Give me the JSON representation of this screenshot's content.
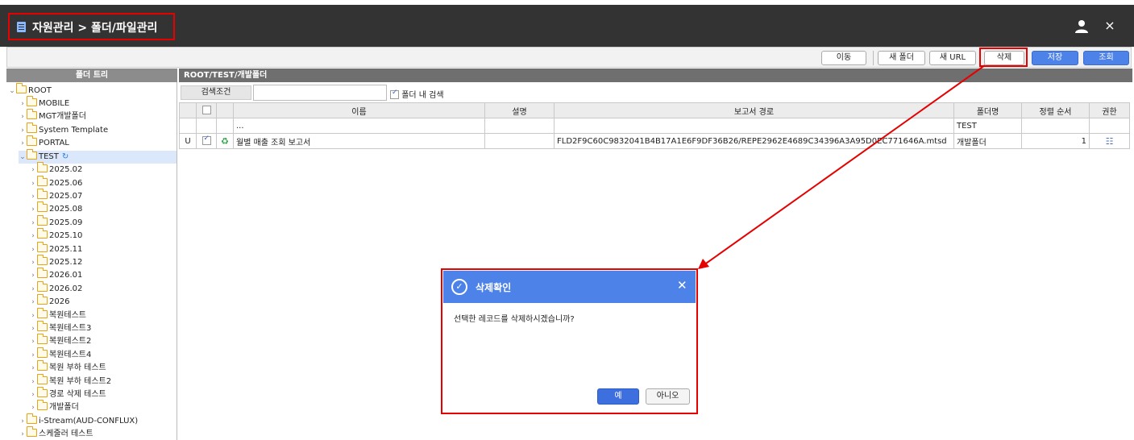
{
  "header": {
    "title": "자원관리 > 폴더/파일관리",
    "user_icon": "user-icon",
    "close": "×"
  },
  "toolbar": {
    "move": "이동",
    "new_folder": "새 폴더",
    "new_url": "새 URL",
    "delete": "삭제",
    "save": "저장",
    "search": "조회",
    "accent": "#4d82e8",
    "highlight": "#e60000"
  },
  "tree": {
    "header": "폴더 트리",
    "nodes": [
      {
        "label": "ROOT"
      },
      {
        "label": "MOBILE"
      },
      {
        "label": "MGT개발폴더"
      },
      {
        "label": "System Template"
      },
      {
        "label": "PORTAL"
      },
      {
        "label": "TEST"
      },
      {
        "label": "2025.02"
      },
      {
        "label": "2025.06"
      },
      {
        "label": "2025.07"
      },
      {
        "label": "2025.08"
      },
      {
        "label": "2025.09"
      },
      {
        "label": "2025.10"
      },
      {
        "label": "2025.11"
      },
      {
        "label": "2025.12"
      },
      {
        "label": "2026.01"
      },
      {
        "label": "2026.02"
      },
      {
        "label": "2026"
      },
      {
        "label": "복원테스트"
      },
      {
        "label": "복원테스트3"
      },
      {
        "label": "복원테스트2"
      },
      {
        "label": "복원테스트4"
      },
      {
        "label": "복원 부하 테스트"
      },
      {
        "label": "복원 부하 테스트2"
      },
      {
        "label": "경로 삭제 테스트"
      },
      {
        "label": "개발폴더"
      },
      {
        "label": "i-Stream(AUD-CONFLUX)"
      },
      {
        "label": "스케줄러 테스트"
      }
    ]
  },
  "main": {
    "path": "ROOT/TEST/개발폴더",
    "search_label": "검색조건",
    "search_value": "",
    "search_in_folder": "폴더 내 검색",
    "columns": [
      "이름",
      "설명",
      "보고서 경로",
      "폴더명",
      "정렬 순서",
      "권한"
    ],
    "rows": [
      {
        "flag": "",
        "name": "...",
        "desc": "",
        "path": "",
        "folder": "TEST",
        "order": "",
        "auth": ""
      },
      {
        "flag": "U",
        "name": "월별 매출 조회 보고서",
        "desc": "",
        "path": "FLD2F9C60C9832041B4B17A1E6F9DF36B26/REPE2962E4689C34396A3A95D0EC771646A.mtsd",
        "folder": "개발폴더",
        "order": "1",
        "auth": "auth-icon"
      }
    ]
  },
  "dialog": {
    "title": "삭제확인",
    "message": "선택한 레코드를 삭제하시겠습니까?",
    "yes": "예",
    "no": "아니오"
  }
}
